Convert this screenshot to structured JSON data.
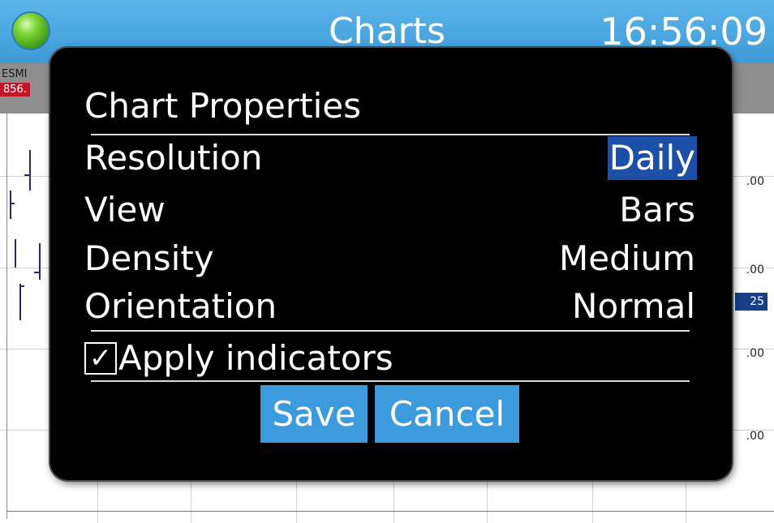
{
  "header": {
    "title": "Charts",
    "clock": "16:56:09",
    "status_icon": "green-status-led"
  },
  "chart_bg": {
    "symbol": "ESMI",
    "price": "856.",
    "axis_ticks": [
      ".00",
      ".00",
      "25",
      ".00",
      ".00"
    ]
  },
  "dialog": {
    "title": "Chart Properties",
    "rows": [
      {
        "label": "Resolution",
        "value": "Daily",
        "selected": true
      },
      {
        "label": "View",
        "value": "Bars",
        "selected": false
      },
      {
        "label": "Density",
        "value": "Medium",
        "selected": false
      },
      {
        "label": "Orientation",
        "value": "Normal",
        "selected": false
      }
    ],
    "checkbox": {
      "label": "Apply indicators",
      "checked": true,
      "check_glyph": "✓"
    },
    "buttons": {
      "save": "Save",
      "cancel": "Cancel"
    }
  },
  "colors": {
    "topbar": "#4aa8e3",
    "selection": "#1c4fa8",
    "button": "#3c9bdd",
    "dialog_bg": "#000000"
  }
}
